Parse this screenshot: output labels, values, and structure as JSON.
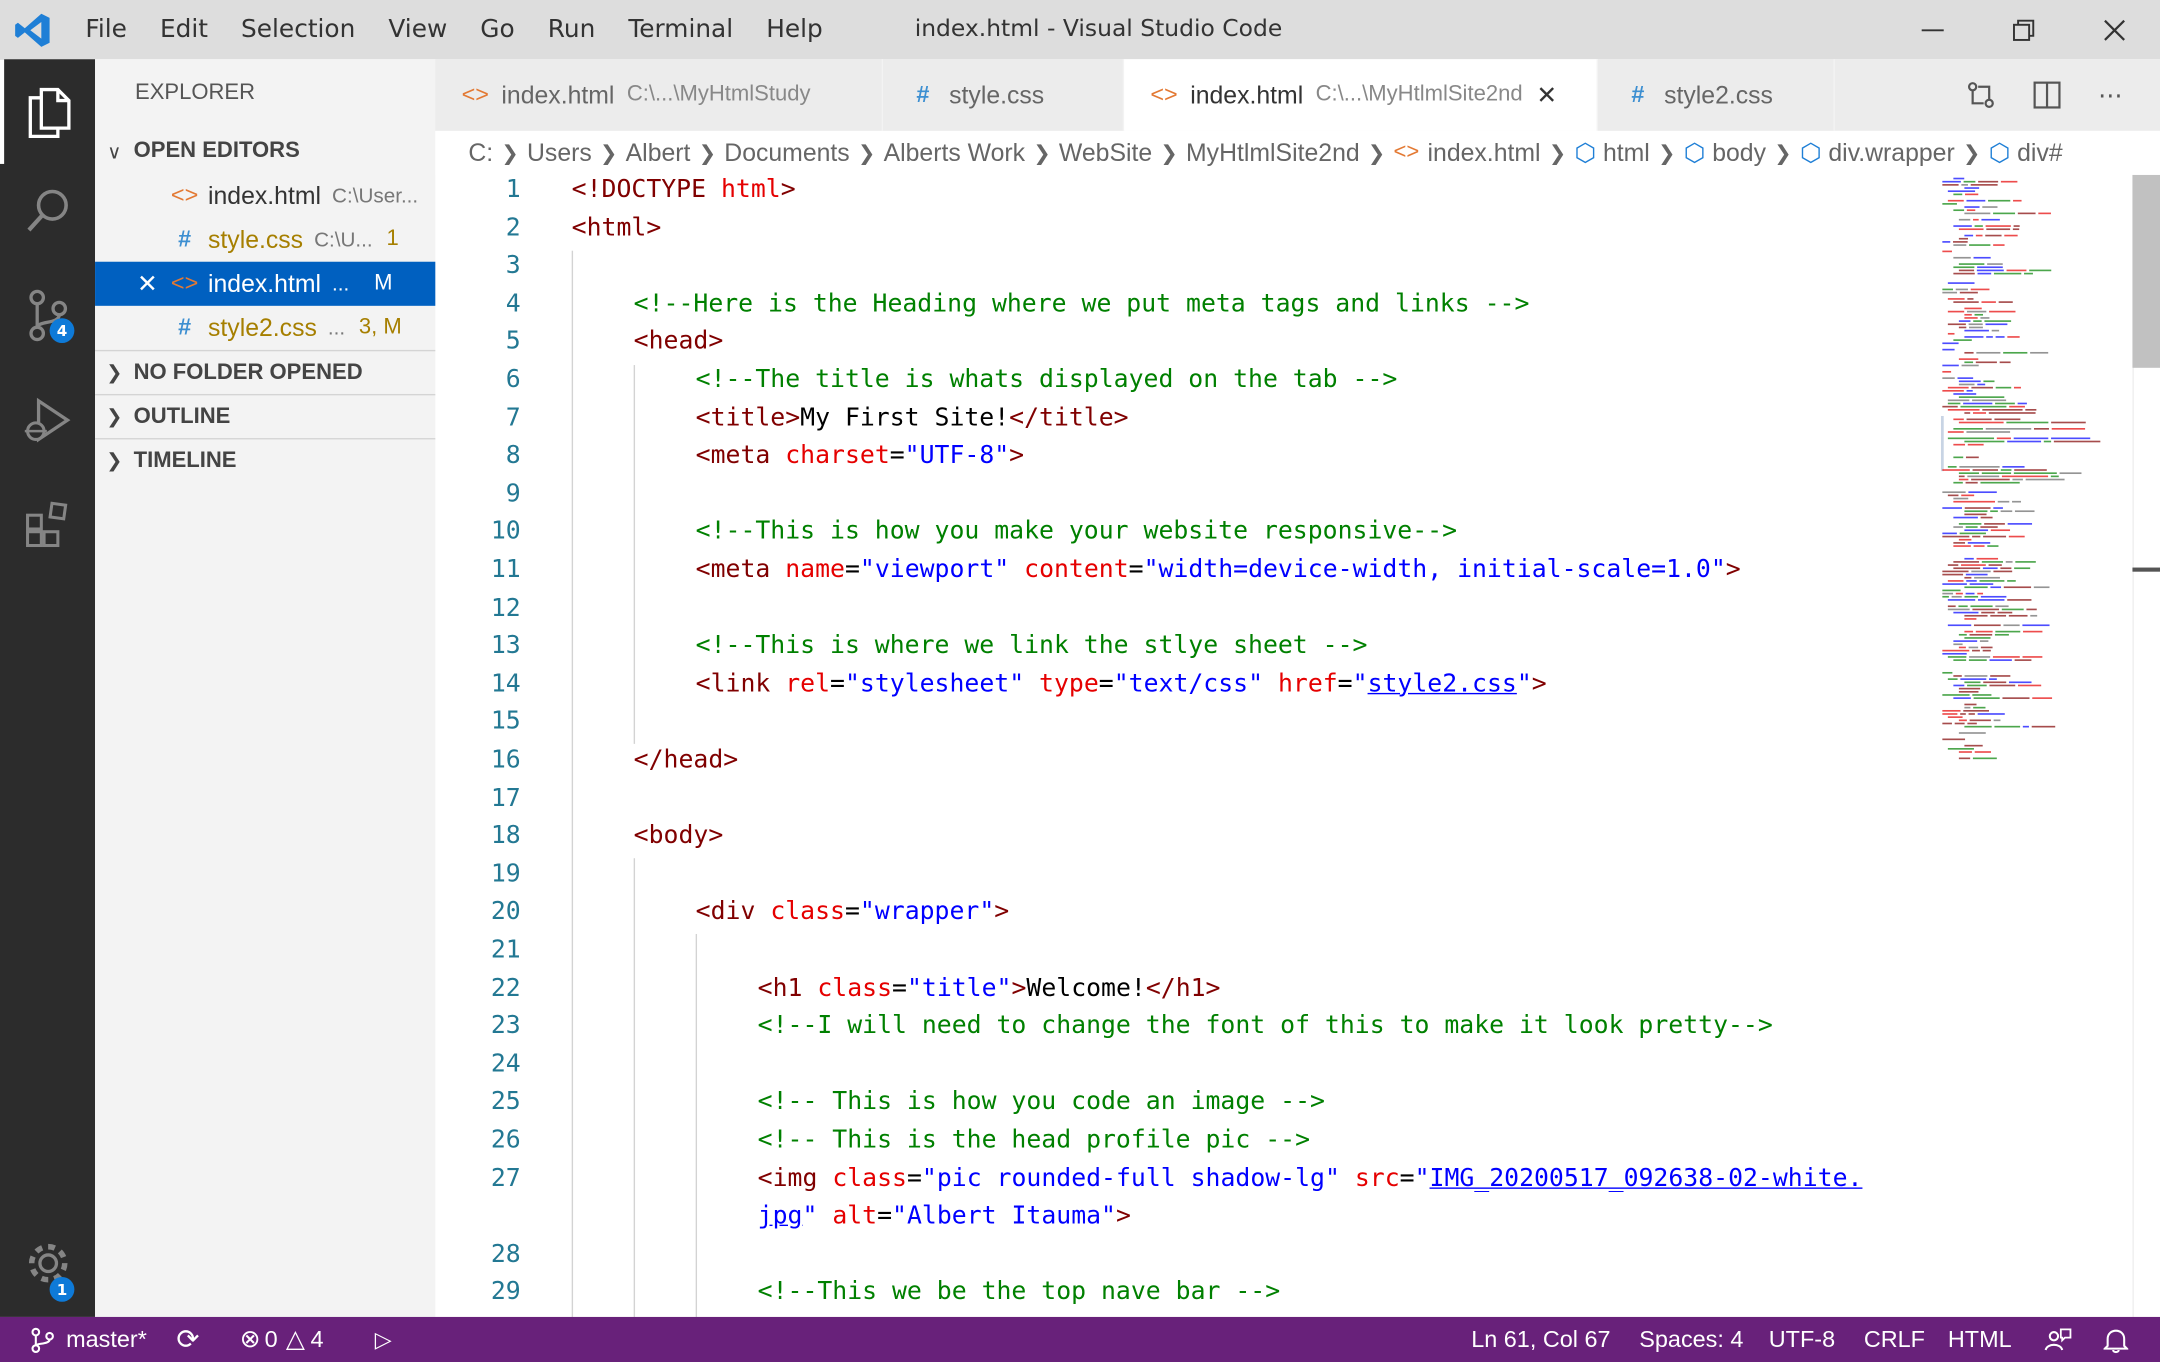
{
  "window": {
    "title": "index.html - Visual Studio Code",
    "menu": [
      "File",
      "Edit",
      "Selection",
      "View",
      "Go",
      "Run",
      "Terminal",
      "Help"
    ]
  },
  "activity_bar": {
    "source_control_badge": "4",
    "settings_badge": "1"
  },
  "sidebar": {
    "title": "EXPLORER",
    "open_editors_label": "OPEN EDITORS",
    "open_editors": [
      {
        "icon": "html-icon",
        "name": "index.html",
        "path": "C:\\User...",
        "status": "",
        "color": "#333333"
      },
      {
        "icon": "css-icon",
        "name": "style.css",
        "path": "C:\\U...",
        "status": "1",
        "color": "#a67f00"
      },
      {
        "icon": "html-icon",
        "name": "index.html",
        "path": "...",
        "status": "M",
        "color": "#ffffff"
      },
      {
        "icon": "css-icon",
        "name": "style2.css",
        "path": "...",
        "status": "3, M",
        "color": "#a67f00"
      }
    ],
    "no_folder_label": "NO FOLDER OPENED",
    "outline_label": "OUTLINE",
    "timeline_label": "TIMELINE"
  },
  "tabs": [
    {
      "icon": "html-icon",
      "name": "index.html",
      "path": "C:\\...\\MyHtmlStudy",
      "active": false
    },
    {
      "icon": "css-icon",
      "name": "style.css",
      "path": "",
      "active": false
    },
    {
      "icon": "html-icon",
      "name": "index.html",
      "path": "C:\\...\\MyHtlmlSite2nd",
      "active": true
    },
    {
      "icon": "css-icon",
      "name": "style2.css",
      "path": "",
      "active": false
    }
  ],
  "breadcrumbs": {
    "segments": [
      "C:",
      "Users",
      "Albert",
      "Documents",
      "Alberts Work",
      "WebSite",
      "MyHtlmlSite2nd"
    ],
    "file": "index.html",
    "symbols": [
      "html",
      "body",
      "div.wrapper",
      "div#"
    ]
  },
  "code": {
    "line_numbers": [
      "1",
      "2",
      "3",
      "4",
      "5",
      "6",
      "7",
      "8",
      "9",
      "10",
      "11",
      "12",
      "13",
      "14",
      "15",
      "16",
      "17",
      "18",
      "19",
      "20",
      "21",
      "22",
      "23",
      "24",
      "25",
      "26",
      "27",
      "",
      "28",
      "29"
    ],
    "lines": {
      "l1_tag": "<!DOCTYPE",
      "l1_kw": "html",
      "l1_close": ">",
      "l2": "<html>",
      "l4": "<!--Here is the Heading where we put meta tags and links -->",
      "l5": "<head>",
      "l6": "<!--The title is whats displayed on the tab -->",
      "l7_open": "<title>",
      "l7_text": "My First Site!",
      "l7_close": "</title>",
      "l8_tag": "<meta",
      "l8_attr": "charset",
      "l8_val": "\"UTF-8\"",
      "l10": "<!--This is how you make your website responsive-->",
      "l11_tag": "<meta",
      "l11_attr1": "name",
      "l11_val1": "\"viewport\"",
      "l11_attr2": "content",
      "l11_val2": "\"width=device-width, initial-scale=1.0\"",
      "l13": "<!--This is where we link the stlye sheet -->",
      "l14_tag": "<link",
      "l14_attr1": "rel",
      "l14_val1": "\"stylesheet\"",
      "l14_attr2": "type",
      "l14_val2": "\"text/css\"",
      "l14_attr3": "href",
      "l14_val3_q": "\"",
      "l14_val3": "style2.css",
      "l16": "</head>",
      "l18": "<body>",
      "l20_tag": "<div",
      "l20_attr": "class",
      "l20_val": "\"wrapper\"",
      "l22_tag": "<h1",
      "l22_attr": "class",
      "l22_val": "\"title\"",
      "l22_text": "Welcome!",
      "l22_close": "</h1>",
      "l23": "<!--I will need to change the font of this to make it look pretty-->",
      "l25": "<!-- This is how you code an image -->",
      "l26": "<!-- This is the head profile pic -->",
      "l27_tag": "<img",
      "l27_attr1": "class",
      "l27_val1": "\"pic rounded-full shadow-lg\"",
      "l27_attr2": "src",
      "l27_val2_q": "\"",
      "l27_val2": "IMG_20200517_092638-02-white.",
      "l27b_val": "jpg",
      "l27b_q": "\"",
      "l27b_attr": "alt",
      "l27b_val2": "\"Albert Itauma\"",
      "l29": "<!--This we be the top nave bar -->"
    }
  },
  "status_bar": {
    "branch": "master*",
    "errors": "0",
    "warnings": "4",
    "position": "Ln 61, Col 67",
    "spaces": "Spaces: 4",
    "encoding": "UTF-8",
    "eol": "CRLF",
    "language": "HTML"
  },
  "colors": {
    "status_bar": "#68217a",
    "activity_bar": "#2c2c2c",
    "selection": "#0060c0",
    "tag": "#800000",
    "attribute": "#e50000",
    "value": "#0000ff",
    "comment": "#008000"
  }
}
